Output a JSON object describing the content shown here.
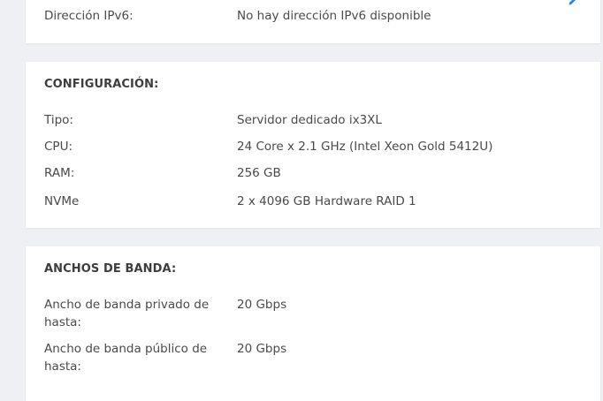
{
  "ip_card": {
    "ipv6_label": "Dirección IPv6:",
    "ipv6_value": "No hay dirección IPv6 disponible"
  },
  "config": {
    "title": "CONFIGURACIÓN:",
    "rows": [
      {
        "label": "Tipo:",
        "value": "Servidor dedicado ix3XL"
      },
      {
        "label": "CPU:",
        "value": "24 Core x 2.1 GHz (Intel Xeon Gold 5412U)"
      },
      {
        "label": "RAM:",
        "value": "256 GB"
      },
      {
        "label": "NVMe",
        "value": "2 x 4096 GB Hardware RAID 1"
      }
    ]
  },
  "bandwidth": {
    "title": "ANCHOS DE BANDA:",
    "rows": [
      {
        "label": "Ancho de banda privado de hasta:",
        "value": "20 Gbps"
      },
      {
        "label": "Ancho de banda público de hasta:",
        "value": "20 Gbps"
      }
    ]
  },
  "colors": {
    "accent": "#2f80ed",
    "background": "#eef0f3",
    "card": "#ffffff",
    "text": "#4a4a4a"
  },
  "icons": {
    "edit": "pencil-icon"
  }
}
